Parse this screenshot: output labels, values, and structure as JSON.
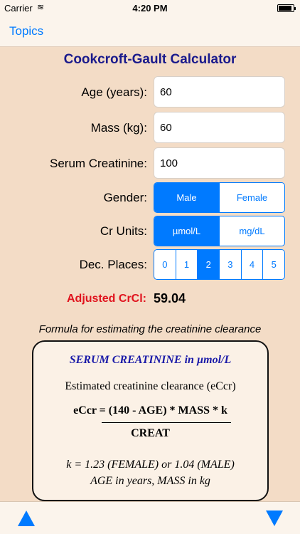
{
  "status": {
    "carrier": "Carrier",
    "time": "4:20 PM"
  },
  "nav": {
    "back_label": "Topics"
  },
  "title": "Cookcroft-Gault Calculator",
  "fields": {
    "age": {
      "label": "Age (years):",
      "value": "60"
    },
    "mass": {
      "label": "Mass (kg):",
      "value": "60"
    },
    "serum": {
      "label": "Serum Creatinine:",
      "value": "100"
    }
  },
  "gender": {
    "label": "Gender:",
    "options": [
      "Male",
      "Female"
    ],
    "selected": "Male"
  },
  "units": {
    "label": "Cr Units:",
    "options": [
      "µmol/L",
      "mg/dL"
    ],
    "selected": "µmol/L"
  },
  "decimals": {
    "label": "Dec. Places:",
    "options": [
      "0",
      "1",
      "2",
      "3",
      "4",
      "5"
    ],
    "selected": "2"
  },
  "result": {
    "label": "Adjusted CrCl:",
    "value": "59.04"
  },
  "formula": {
    "caption": "Formula for estimating the creatinine clearance",
    "heading": "SERUM CREATININE in µmol/L",
    "subtitle": "Estimated creatinine clearance (eCcr)",
    "numerator": "eCcr = (140 - AGE) * MASS * k",
    "denominator": "CREAT",
    "k_line": "k = 1.23 (FEMALE) or 1.04 (MALE)",
    "age_line": "AGE in years, MASS in kg"
  },
  "colors": {
    "accent": "#007aff",
    "title": "#1a1a8c",
    "result_label": "#e0141e",
    "background": "#f3dcc6"
  }
}
